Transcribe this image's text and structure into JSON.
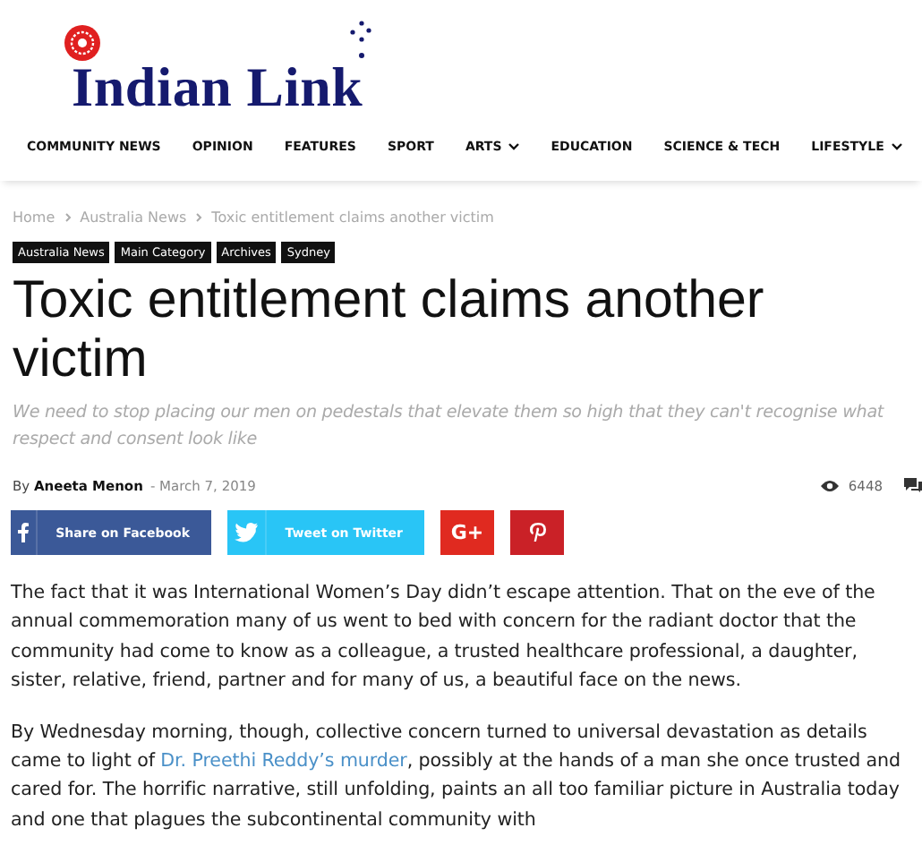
{
  "site": {
    "name": "Indian Link"
  },
  "nav": [
    {
      "label": "COMMUNITY NEWS",
      "has_menu": false
    },
    {
      "label": "OPINION",
      "has_menu": false
    },
    {
      "label": "FEATURES",
      "has_menu": false
    },
    {
      "label": "SPORT",
      "has_menu": false
    },
    {
      "label": "ARTS",
      "has_menu": true
    },
    {
      "label": "EDUCATION",
      "has_menu": false
    },
    {
      "label": "SCIENCE & TECH",
      "has_menu": false
    },
    {
      "label": "LIFESTYLE",
      "has_menu": true
    }
  ],
  "breadcrumb": [
    "Home",
    "Australia News",
    "Toxic entitlement claims another victim"
  ],
  "tags": [
    "Australia News",
    "Main Category",
    "Archives",
    "Sydney"
  ],
  "article": {
    "title": "Toxic entitlement claims another victim",
    "subtitle": "We need to stop placing our men on pedestals that elevate them so high that they can't recognise what respect and consent look like",
    "author_prefix": "By",
    "author": "Aneeta Menon",
    "separator": "-",
    "date": "March 7, 2019",
    "views": "6448"
  },
  "share": [
    {
      "kind": "facebook",
      "label": "Share on Facebook"
    },
    {
      "kind": "twitter",
      "label": "Tweet on Twitter"
    },
    {
      "kind": "googleplus",
      "label": "G+"
    },
    {
      "kind": "pinterest"
    }
  ],
  "body": [
    {
      "before": "The fact that it was International Women’s Day didn’t escape attention. That on the eve of the annual commemoration many of us went to bed with concern for the radiant doctor that the community had come to know as a colleague, a trusted healthcare professional, a daughter, sister, relative, friend, partner and for many of us, a beautiful face on the news."
    },
    {
      "before": "By Wednesday morning, though, collective concern turned to universal devastation as details came to light of ",
      "link": "Dr. Preethi Reddy’s murder",
      "after": ", possibly at the hands of a man she once trusted and cared for. The horrific narrative, still unfolding, paints an all too familiar picture in Australia today and one that plagues the subcontinental community with"
    }
  ]
}
